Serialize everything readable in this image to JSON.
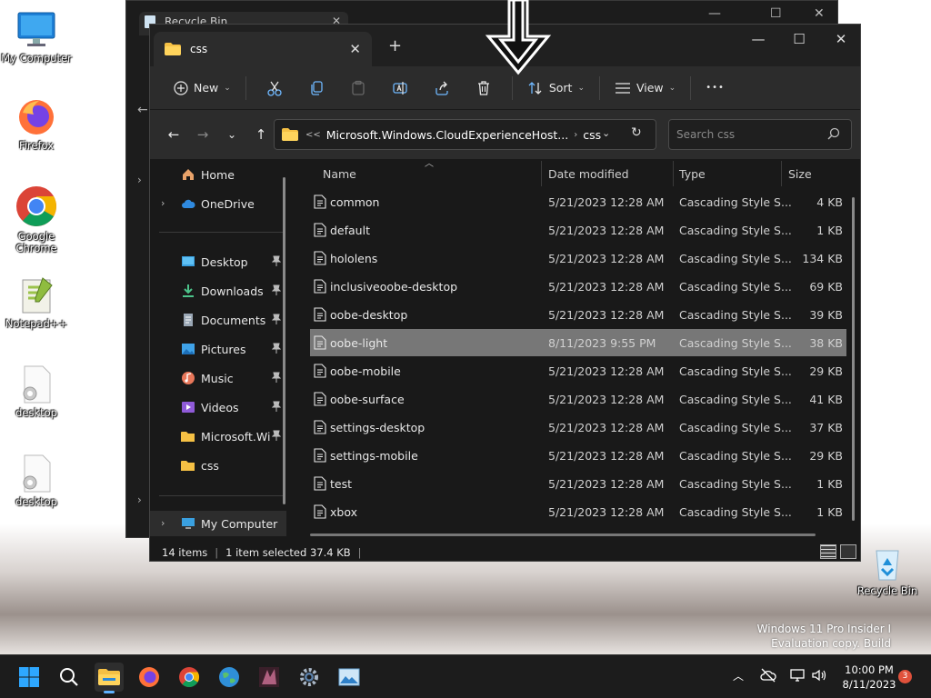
{
  "desktop": {
    "icons": [
      {
        "label": "My Computer"
      },
      {
        "label": "Firefox"
      },
      {
        "label": "Google Chrome"
      },
      {
        "label": "Notepad++"
      },
      {
        "label": "desktop"
      },
      {
        "label": "desktop"
      },
      {
        "label": "Recycle Bin"
      }
    ],
    "watermark_line1": "Windows 11 Pro Insider I",
    "watermark_line2": "Evaluation copy. Build"
  },
  "bg_window": {
    "tab_title": "Recycle Bin"
  },
  "window": {
    "tab_title": "css",
    "toolbar": {
      "new_label": "New",
      "sort_label": "Sort",
      "view_label": "View",
      "more_label": "•••"
    },
    "address": {
      "overflow": "<<",
      "crumb1": "Microsoft.Windows.CloudExperienceHost...",
      "crumb2": "css"
    },
    "search": {
      "placeholder": "Search css"
    },
    "nav": {
      "home": "Home",
      "onedrive": "OneDrive",
      "pinned": [
        {
          "label": "Desktop"
        },
        {
          "label": "Downloads"
        },
        {
          "label": "Documents"
        },
        {
          "label": "Pictures"
        },
        {
          "label": "Music"
        },
        {
          "label": "Videos"
        },
        {
          "label": "Microsoft.Wi"
        },
        {
          "label": "css"
        }
      ],
      "my_computer": "My Computer"
    },
    "columns": {
      "name": "Name",
      "date": "Date modified",
      "type": "Type",
      "size": "Size"
    },
    "files": [
      {
        "name": "common",
        "date": "5/21/2023 12:28 AM",
        "type": "Cascading Style S...",
        "size": "4 KB"
      },
      {
        "name": "default",
        "date": "5/21/2023 12:28 AM",
        "type": "Cascading Style S...",
        "size": "1 KB"
      },
      {
        "name": "hololens",
        "date": "5/21/2023 12:28 AM",
        "type": "Cascading Style S...",
        "size": "134 KB"
      },
      {
        "name": "inclusiveoobe-desktop",
        "date": "5/21/2023 12:28 AM",
        "type": "Cascading Style S...",
        "size": "69 KB"
      },
      {
        "name": "oobe-desktop",
        "date": "5/21/2023 12:28 AM",
        "type": "Cascading Style S...",
        "size": "39 KB"
      },
      {
        "name": "oobe-light",
        "date": "8/11/2023 9:55 PM",
        "type": "Cascading Style S...",
        "size": "38 KB"
      },
      {
        "name": "oobe-mobile",
        "date": "5/21/2023 12:28 AM",
        "type": "Cascading Style S...",
        "size": "29 KB"
      },
      {
        "name": "oobe-surface",
        "date": "5/21/2023 12:28 AM",
        "type": "Cascading Style S...",
        "size": "41 KB"
      },
      {
        "name": "settings-desktop",
        "date": "5/21/2023 12:28 AM",
        "type": "Cascading Style S...",
        "size": "37 KB"
      },
      {
        "name": "settings-mobile",
        "date": "5/21/2023 12:28 AM",
        "type": "Cascading Style S...",
        "size": "29 KB"
      },
      {
        "name": "test",
        "date": "5/21/2023 12:28 AM",
        "type": "Cascading Style S...",
        "size": "1 KB"
      },
      {
        "name": "xbox",
        "date": "5/21/2023 12:28 AM",
        "type": "Cascading Style S...",
        "size": "1 KB"
      }
    ],
    "status": {
      "count": "14 items",
      "selected": "1 item selected  37.4 KB"
    }
  },
  "taskbar": {
    "time": "10:00 PM",
    "date": "8/11/2023",
    "notifications": "3"
  },
  "colors": {
    "accent": "#5fb2ff",
    "selection": "#777777",
    "window_bg": "#191919",
    "toolbar_bg": "#2c2c2c"
  }
}
